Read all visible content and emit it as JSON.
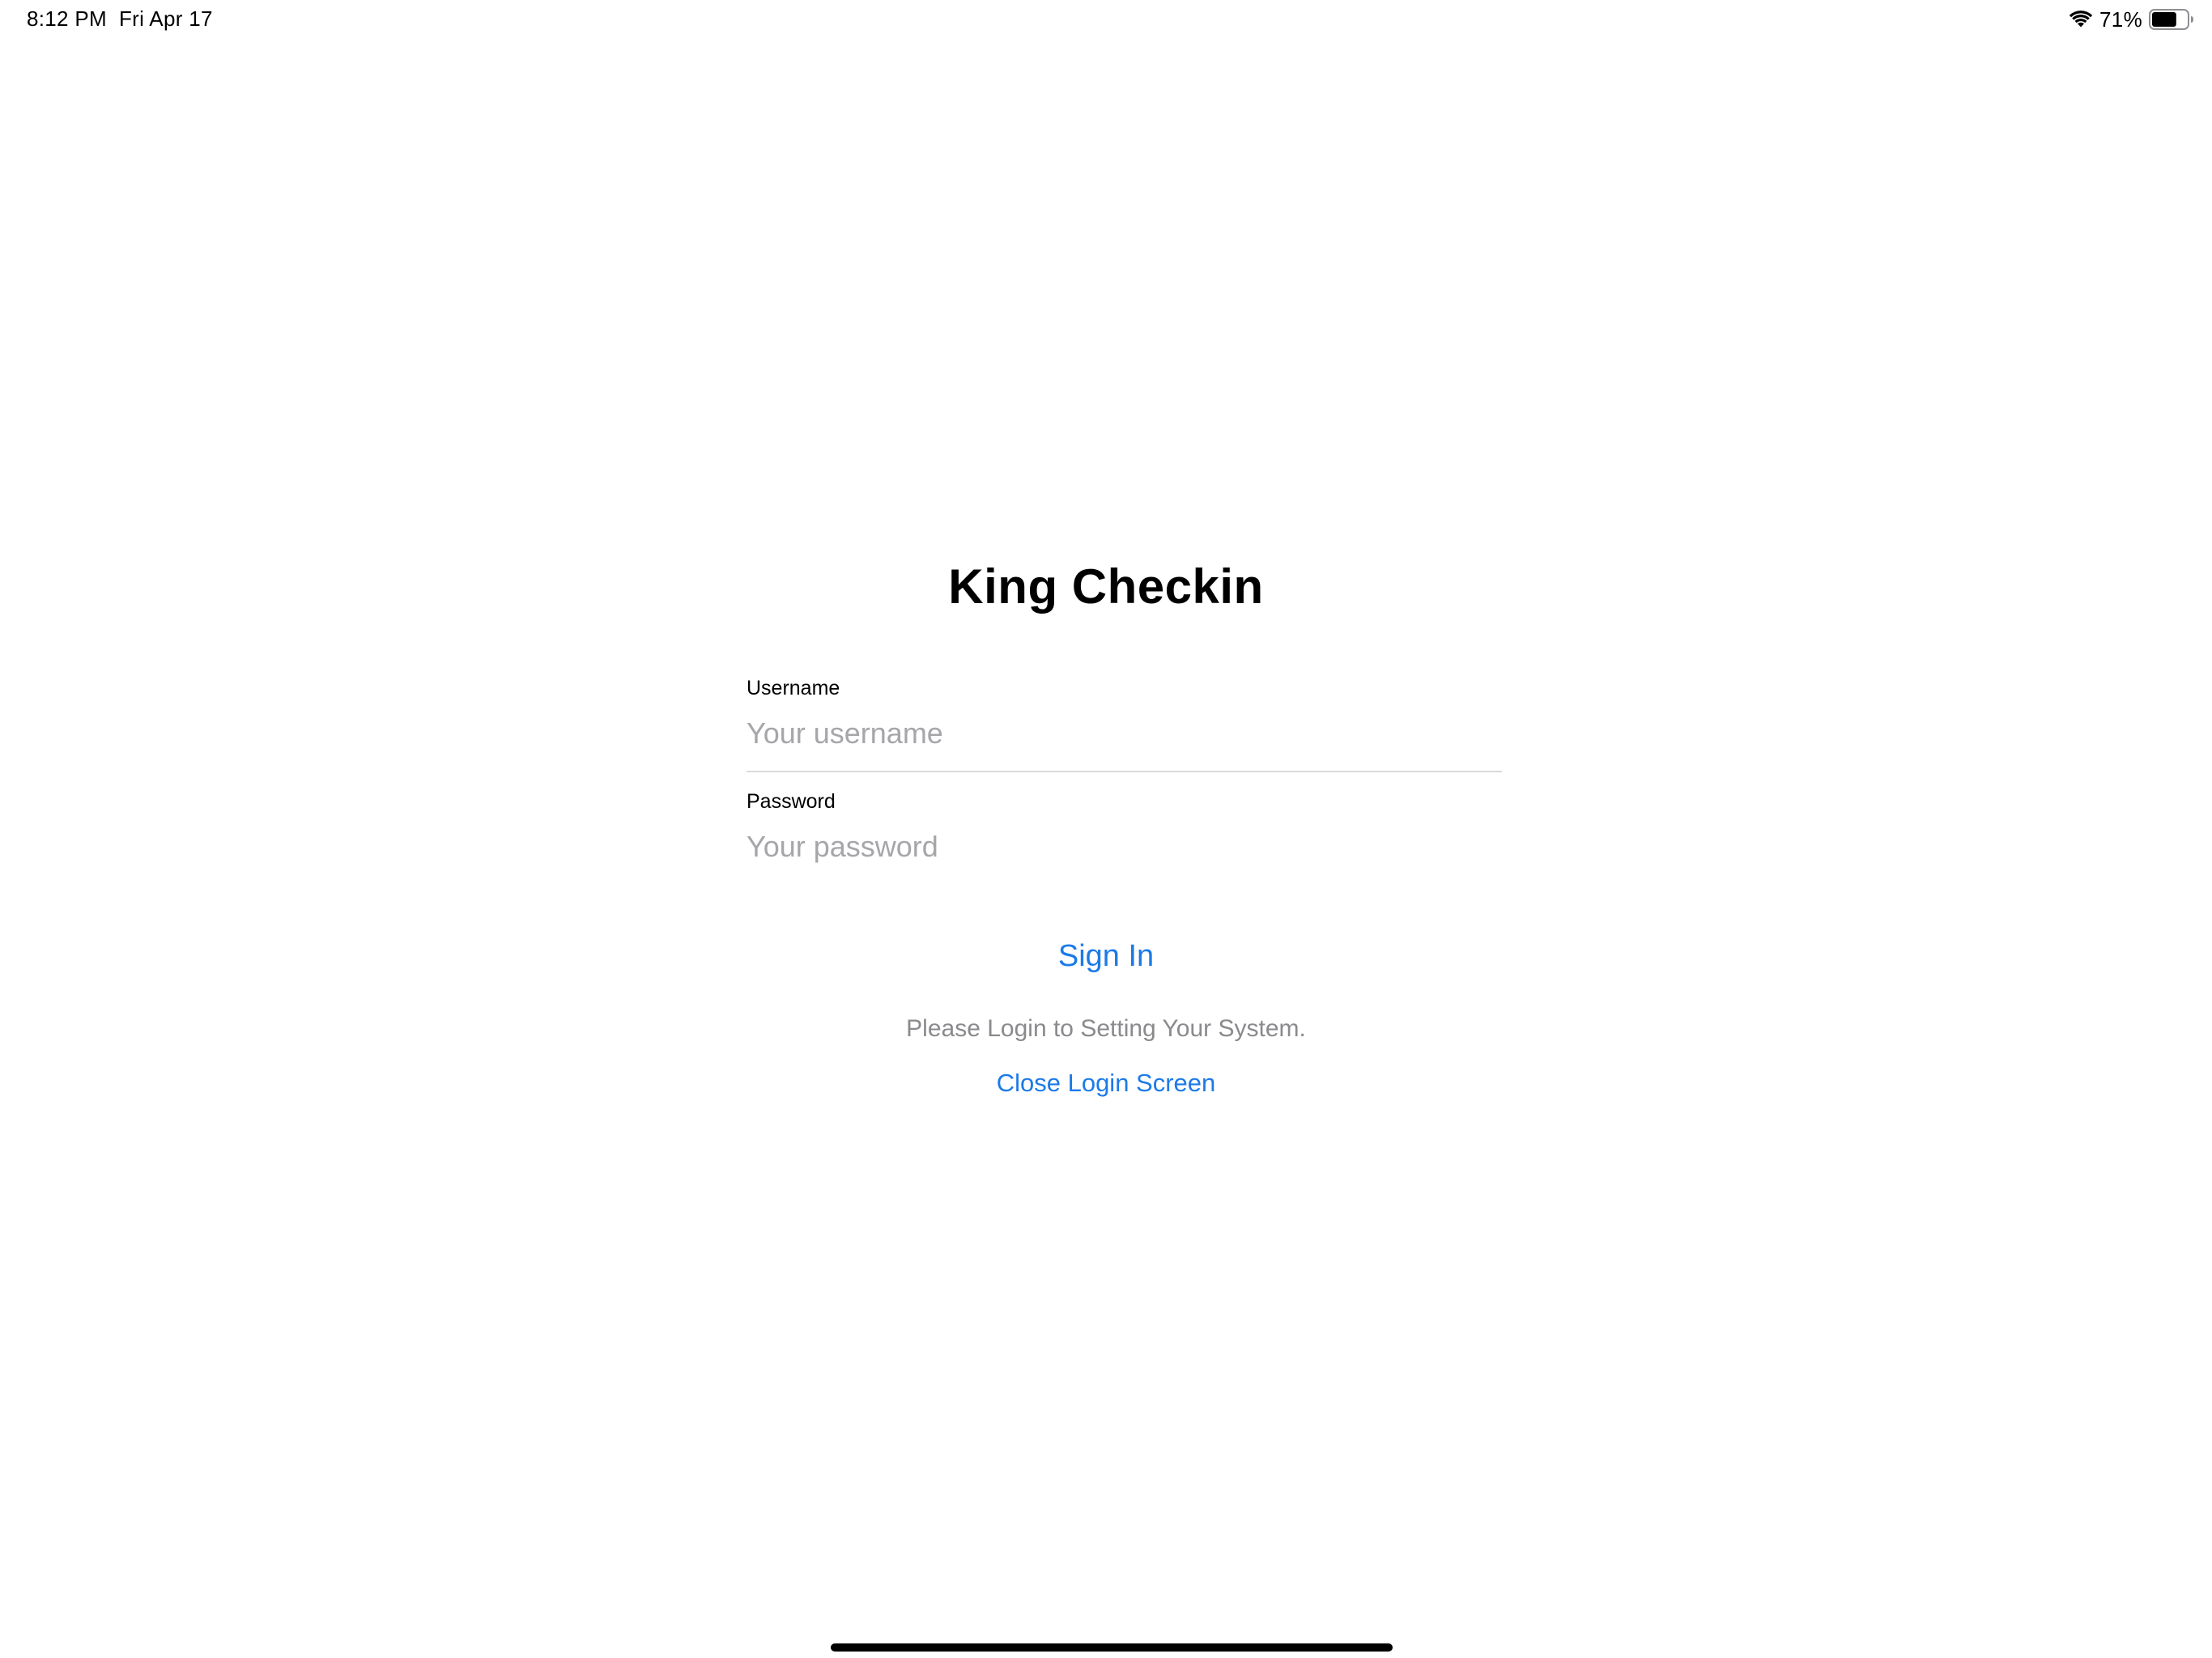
{
  "status_bar": {
    "time": "8:12 PM",
    "date": "Fri Apr 17",
    "battery_percent": "71%",
    "battery_level": 0.71,
    "icons": [
      "wifi-icon",
      "battery-icon"
    ]
  },
  "app": {
    "title": "King Checkin"
  },
  "form": {
    "username_label": "Username",
    "username_placeholder": "Your username",
    "username_value": "",
    "password_label": "Password",
    "password_placeholder": "Your password",
    "password_value": ""
  },
  "actions": {
    "sign_in_label": "Sign In",
    "hint": "Please Login to Setting Your System.",
    "close_label": "Close Login Screen"
  },
  "colors": {
    "accent": "#1c7ae8",
    "placeholder": "#a6a6aa",
    "hint_text": "#8a8a8e",
    "divider": "#d9d9dc",
    "background": "#ffffff"
  }
}
